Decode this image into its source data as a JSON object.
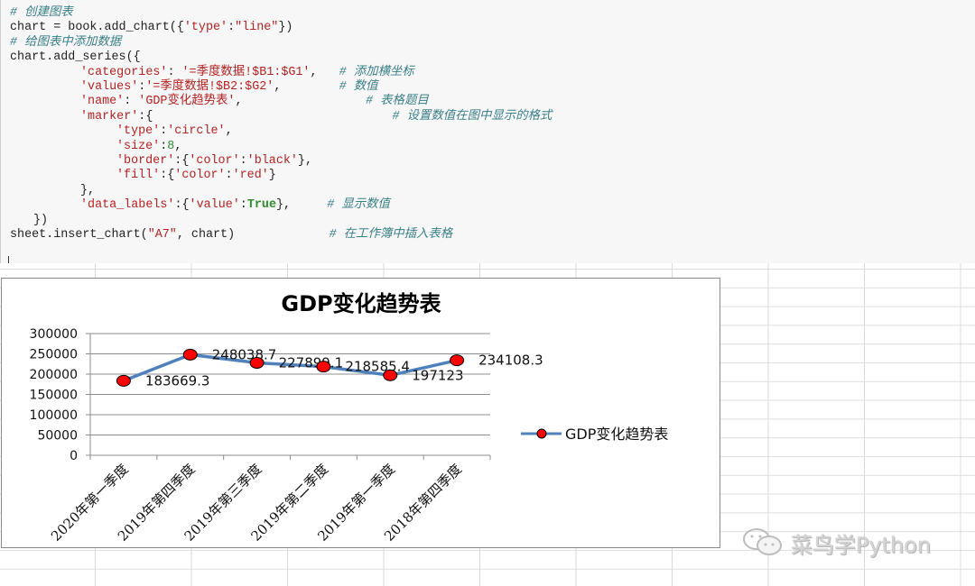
{
  "code": {
    "lines": [
      {
        "indent": 0,
        "tokens": [
          {
            "t": "cm",
            "v": "# 创建图表"
          }
        ]
      },
      {
        "indent": 0,
        "tokens": [
          {
            "t": "pl",
            "v": "chart = book.add_chart({"
          },
          {
            "t": "st",
            "v": "'type'"
          },
          {
            "t": "pl",
            "v": ":"
          },
          {
            "t": "st",
            "v": "\"line\""
          },
          {
            "t": "pl",
            "v": "})"
          }
        ]
      },
      {
        "indent": 0,
        "tokens": [
          {
            "t": "cm",
            "v": "# 给图表中添加数据"
          }
        ]
      },
      {
        "indent": 0,
        "tokens": [
          {
            "t": "pl",
            "v": "chart.add_series({"
          }
        ]
      },
      {
        "indent": 2,
        "tokens": [
          {
            "t": "st",
            "v": "'categories'"
          },
          {
            "t": "pl",
            "v": ": "
          },
          {
            "t": "st",
            "v": "'=季度数据!$B1:$G1'"
          },
          {
            "t": "pl",
            "v": ",   "
          },
          {
            "t": "cm",
            "v": "# 添加横坐标"
          }
        ]
      },
      {
        "indent": 2,
        "tokens": [
          {
            "t": "st",
            "v": "'values'"
          },
          {
            "t": "pl",
            "v": ":"
          },
          {
            "t": "st",
            "v": "'=季度数据!$B2:$G2'"
          },
          {
            "t": "pl",
            "v": ",        "
          },
          {
            "t": "cm",
            "v": "# 数值"
          }
        ]
      },
      {
        "indent": 2,
        "tokens": [
          {
            "t": "st",
            "v": "'name'"
          },
          {
            "t": "pl",
            "v": ": "
          },
          {
            "t": "st",
            "v": "'GDP变化趋势表'"
          },
          {
            "t": "pl",
            "v": ",                 "
          },
          {
            "t": "cm",
            "v": "# 表格题目"
          }
        ]
      },
      {
        "indent": 2,
        "tokens": [
          {
            "t": "st",
            "v": "'marker'"
          },
          {
            "t": "pl",
            "v": ":{                                 "
          },
          {
            "t": "cm",
            "v": "# 设置数值在图中显示的格式"
          }
        ]
      },
      {
        "indent": 3,
        "tokens": [
          {
            "t": "st",
            "v": "'type'"
          },
          {
            "t": "pl",
            "v": ":"
          },
          {
            "t": "st",
            "v": "'circle'"
          },
          {
            "t": "pl",
            "v": ","
          }
        ]
      },
      {
        "indent": 3,
        "tokens": [
          {
            "t": "st",
            "v": "'size'"
          },
          {
            "t": "pl",
            "v": ":"
          },
          {
            "t": "nm",
            "v": "8"
          },
          {
            "t": "pl",
            "v": ","
          }
        ]
      },
      {
        "indent": 3,
        "tokens": [
          {
            "t": "st",
            "v": "'border'"
          },
          {
            "t": "pl",
            "v": ":{"
          },
          {
            "t": "st",
            "v": "'color'"
          },
          {
            "t": "pl",
            "v": ":"
          },
          {
            "t": "st",
            "v": "'black'"
          },
          {
            "t": "pl",
            "v": "},"
          }
        ]
      },
      {
        "indent": 3,
        "tokens": [
          {
            "t": "st",
            "v": "'fill'"
          },
          {
            "t": "pl",
            "v": ":{"
          },
          {
            "t": "st",
            "v": "'color'"
          },
          {
            "t": "pl",
            "v": ":"
          },
          {
            "t": "st",
            "v": "'red'"
          },
          {
            "t": "pl",
            "v": "}"
          }
        ]
      },
      {
        "indent": 2,
        "tokens": [
          {
            "t": "pl",
            "v": "},"
          }
        ]
      },
      {
        "indent": 2,
        "tokens": [
          {
            "t": "st",
            "v": "'data_labels'"
          },
          {
            "t": "pl",
            "v": ":{"
          },
          {
            "t": "st",
            "v": "'value'"
          },
          {
            "t": "pl",
            "v": ":"
          },
          {
            "t": "kw",
            "v": "True"
          },
          {
            "t": "pl",
            "v": "},     "
          },
          {
            "t": "cm",
            "v": "# 显示数值"
          }
        ]
      },
      {
        "indent": 1,
        "tokens": [
          {
            "t": "pl",
            "v": "})"
          }
        ]
      },
      {
        "indent": 0,
        "tokens": [
          {
            "t": "pl",
            "v": "sheet.insert_chart("
          },
          {
            "t": "st",
            "v": "\"A7\""
          },
          {
            "t": "pl",
            "v": ", chart)             "
          },
          {
            "t": "cm",
            "v": "# 在工作簿中插入表格"
          }
        ]
      }
    ]
  },
  "chart_data": {
    "type": "line",
    "title": "GDP变化趋势表",
    "categories": [
      "2020年第一季度",
      "2019年第四季度",
      "2019年第三季度",
      "2019年第二季度",
      "2019年第一季度",
      "2018年第四季度"
    ],
    "series": [
      {
        "name": "GDP变化趋势表",
        "values": [
          183669.3,
          248038.7,
          227899.1,
          218585.4,
          197123,
          234108.3
        ],
        "data_labels": [
          "183669.3",
          "248038.7",
          "227899.1",
          "218585.4",
          "197123",
          "234108.3"
        ],
        "line_color": "#4f81bd",
        "marker": {
          "type": "circle",
          "fill": "#ff0000",
          "border": "#000000"
        }
      }
    ],
    "xlabel": "",
    "ylabel": "",
    "ylim": [
      0,
      300000
    ],
    "yticks": [
      0,
      50000,
      100000,
      150000,
      200000,
      250000,
      300000
    ],
    "ytick_labels": [
      "0",
      "50000",
      "100000",
      "150000",
      "200000",
      "250000",
      "300000"
    ],
    "grid": true,
    "legend": {
      "position": "right",
      "label": "GDP变化趋势表"
    }
  },
  "watermark": {
    "icon": "wechat-icon",
    "text": "菜鸟学Python"
  }
}
